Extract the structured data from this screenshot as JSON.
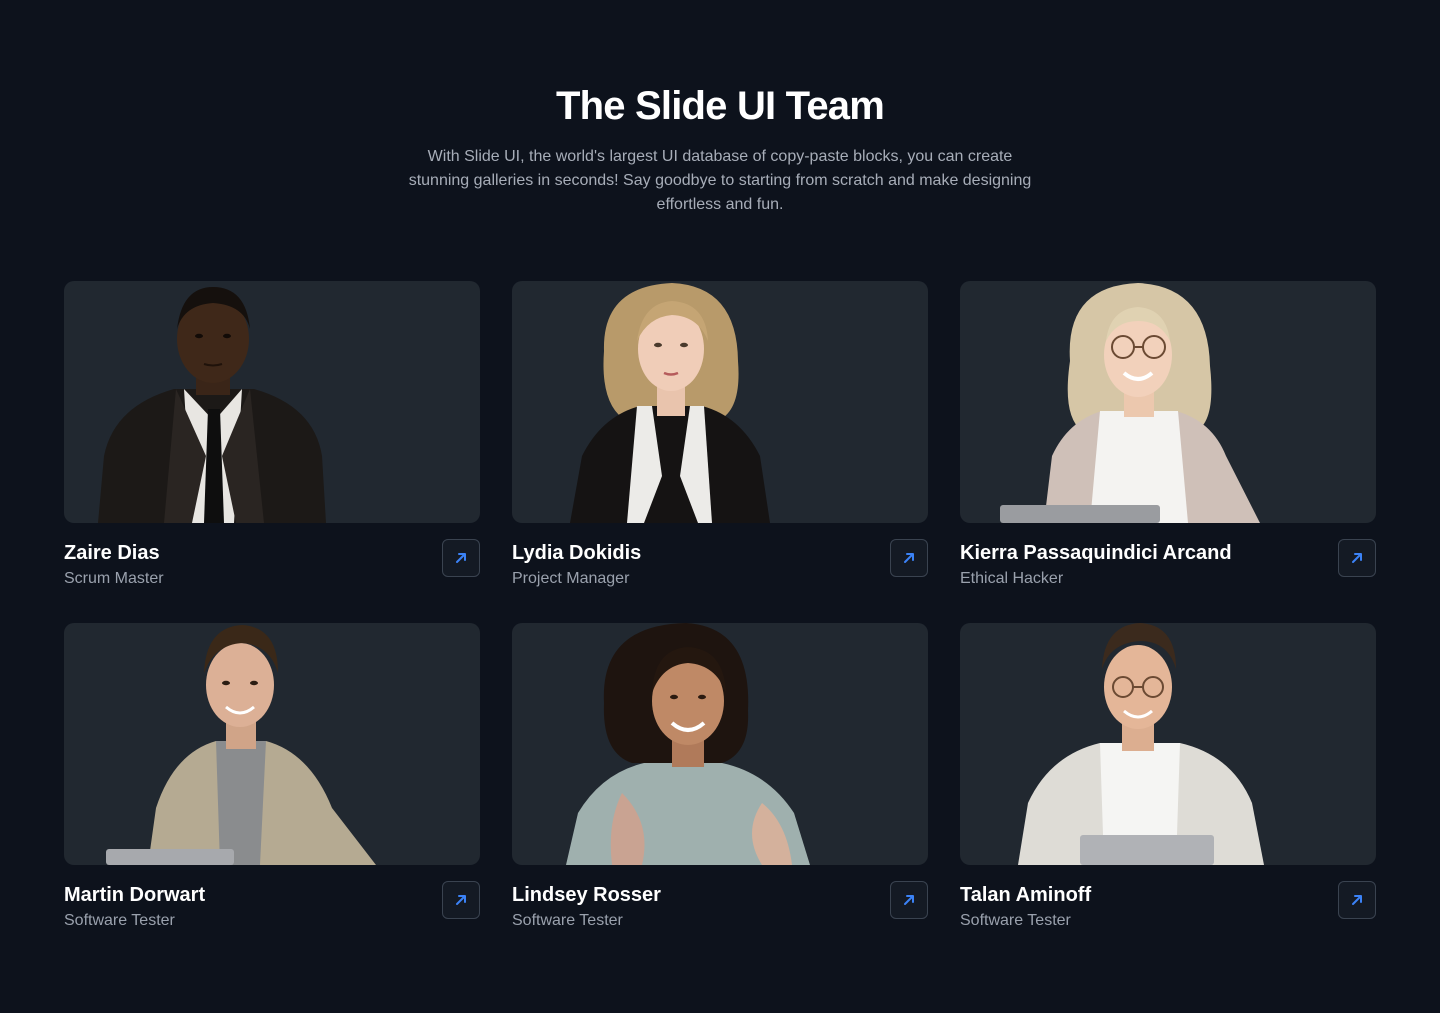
{
  "header": {
    "title": "The Slide UI Team",
    "subtitle": "With Slide UI, the world's largest UI database of copy-paste blocks, you can create stunning galleries in seconds! Say goodbye to starting from scratch and make designing effortless and fun."
  },
  "team": [
    {
      "name": "Zaire Dias",
      "role": "Scrum Master"
    },
    {
      "name": "Lydia Dokidis",
      "role": "Project Manager"
    },
    {
      "name": "Kierra Passaquindici Arcand",
      "role": "Ethical Hacker"
    },
    {
      "name": "Martin Dorwart",
      "role": "Software Tester"
    },
    {
      "name": "Lindsey Rosser",
      "role": "Software Tester"
    },
    {
      "name": "Talan Aminoff",
      "role": "Software Tester"
    }
  ],
  "icons": {
    "link_button": "arrow-up-right-icon"
  },
  "colors": {
    "background": "#0d121c",
    "card": "#212830",
    "accent": "#3b82f6",
    "muted_text": "#9aa1ad"
  }
}
